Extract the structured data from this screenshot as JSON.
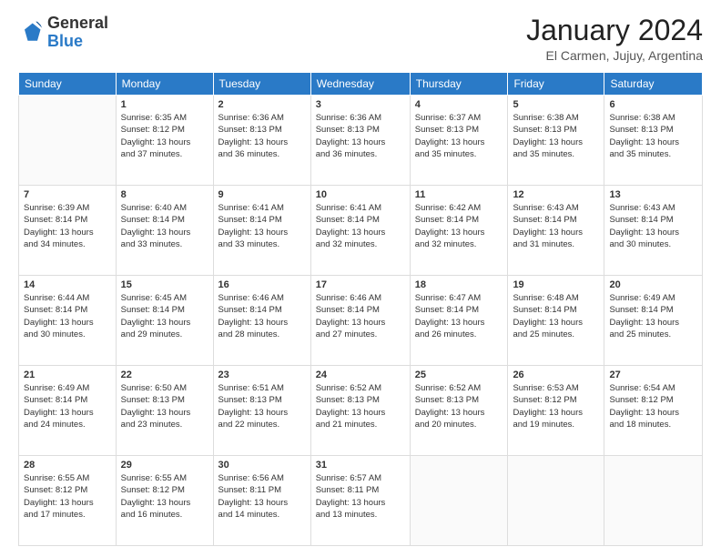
{
  "header": {
    "logo": {
      "general": "General",
      "blue": "Blue"
    },
    "title": "January 2024",
    "subtitle": "El Carmen, Jujuy, Argentina"
  },
  "calendar": {
    "days_of_week": [
      "Sunday",
      "Monday",
      "Tuesday",
      "Wednesday",
      "Thursday",
      "Friday",
      "Saturday"
    ],
    "weeks": [
      [
        {
          "day": "",
          "info": ""
        },
        {
          "day": "1",
          "info": "Sunrise: 6:35 AM\nSunset: 8:12 PM\nDaylight: 13 hours\nand 37 minutes."
        },
        {
          "day": "2",
          "info": "Sunrise: 6:36 AM\nSunset: 8:13 PM\nDaylight: 13 hours\nand 36 minutes."
        },
        {
          "day": "3",
          "info": "Sunrise: 6:36 AM\nSunset: 8:13 PM\nDaylight: 13 hours\nand 36 minutes."
        },
        {
          "day": "4",
          "info": "Sunrise: 6:37 AM\nSunset: 8:13 PM\nDaylight: 13 hours\nand 35 minutes."
        },
        {
          "day": "5",
          "info": "Sunrise: 6:38 AM\nSunset: 8:13 PM\nDaylight: 13 hours\nand 35 minutes."
        },
        {
          "day": "6",
          "info": "Sunrise: 6:38 AM\nSunset: 8:13 PM\nDaylight: 13 hours\nand 35 minutes."
        }
      ],
      [
        {
          "day": "7",
          "info": "Sunrise: 6:39 AM\nSunset: 8:14 PM\nDaylight: 13 hours\nand 34 minutes."
        },
        {
          "day": "8",
          "info": "Sunrise: 6:40 AM\nSunset: 8:14 PM\nDaylight: 13 hours\nand 33 minutes."
        },
        {
          "day": "9",
          "info": "Sunrise: 6:41 AM\nSunset: 8:14 PM\nDaylight: 13 hours\nand 33 minutes."
        },
        {
          "day": "10",
          "info": "Sunrise: 6:41 AM\nSunset: 8:14 PM\nDaylight: 13 hours\nand 32 minutes."
        },
        {
          "day": "11",
          "info": "Sunrise: 6:42 AM\nSunset: 8:14 PM\nDaylight: 13 hours\nand 32 minutes."
        },
        {
          "day": "12",
          "info": "Sunrise: 6:43 AM\nSunset: 8:14 PM\nDaylight: 13 hours\nand 31 minutes."
        },
        {
          "day": "13",
          "info": "Sunrise: 6:43 AM\nSunset: 8:14 PM\nDaylight: 13 hours\nand 30 minutes."
        }
      ],
      [
        {
          "day": "14",
          "info": "Sunrise: 6:44 AM\nSunset: 8:14 PM\nDaylight: 13 hours\nand 30 minutes."
        },
        {
          "day": "15",
          "info": "Sunrise: 6:45 AM\nSunset: 8:14 PM\nDaylight: 13 hours\nand 29 minutes."
        },
        {
          "day": "16",
          "info": "Sunrise: 6:46 AM\nSunset: 8:14 PM\nDaylight: 13 hours\nand 28 minutes."
        },
        {
          "day": "17",
          "info": "Sunrise: 6:46 AM\nSunset: 8:14 PM\nDaylight: 13 hours\nand 27 minutes."
        },
        {
          "day": "18",
          "info": "Sunrise: 6:47 AM\nSunset: 8:14 PM\nDaylight: 13 hours\nand 26 minutes."
        },
        {
          "day": "19",
          "info": "Sunrise: 6:48 AM\nSunset: 8:14 PM\nDaylight: 13 hours\nand 25 minutes."
        },
        {
          "day": "20",
          "info": "Sunrise: 6:49 AM\nSunset: 8:14 PM\nDaylight: 13 hours\nand 25 minutes."
        }
      ],
      [
        {
          "day": "21",
          "info": "Sunrise: 6:49 AM\nSunset: 8:14 PM\nDaylight: 13 hours\nand 24 minutes."
        },
        {
          "day": "22",
          "info": "Sunrise: 6:50 AM\nSunset: 8:13 PM\nDaylight: 13 hours\nand 23 minutes."
        },
        {
          "day": "23",
          "info": "Sunrise: 6:51 AM\nSunset: 8:13 PM\nDaylight: 13 hours\nand 22 minutes."
        },
        {
          "day": "24",
          "info": "Sunrise: 6:52 AM\nSunset: 8:13 PM\nDaylight: 13 hours\nand 21 minutes."
        },
        {
          "day": "25",
          "info": "Sunrise: 6:52 AM\nSunset: 8:13 PM\nDaylight: 13 hours\nand 20 minutes."
        },
        {
          "day": "26",
          "info": "Sunrise: 6:53 AM\nSunset: 8:12 PM\nDaylight: 13 hours\nand 19 minutes."
        },
        {
          "day": "27",
          "info": "Sunrise: 6:54 AM\nSunset: 8:12 PM\nDaylight: 13 hours\nand 18 minutes."
        }
      ],
      [
        {
          "day": "28",
          "info": "Sunrise: 6:55 AM\nSunset: 8:12 PM\nDaylight: 13 hours\nand 17 minutes."
        },
        {
          "day": "29",
          "info": "Sunrise: 6:55 AM\nSunset: 8:12 PM\nDaylight: 13 hours\nand 16 minutes."
        },
        {
          "day": "30",
          "info": "Sunrise: 6:56 AM\nSunset: 8:11 PM\nDaylight: 13 hours\nand 14 minutes."
        },
        {
          "day": "31",
          "info": "Sunrise: 6:57 AM\nSunset: 8:11 PM\nDaylight: 13 hours\nand 13 minutes."
        },
        {
          "day": "",
          "info": ""
        },
        {
          "day": "",
          "info": ""
        },
        {
          "day": "",
          "info": ""
        }
      ]
    ]
  }
}
